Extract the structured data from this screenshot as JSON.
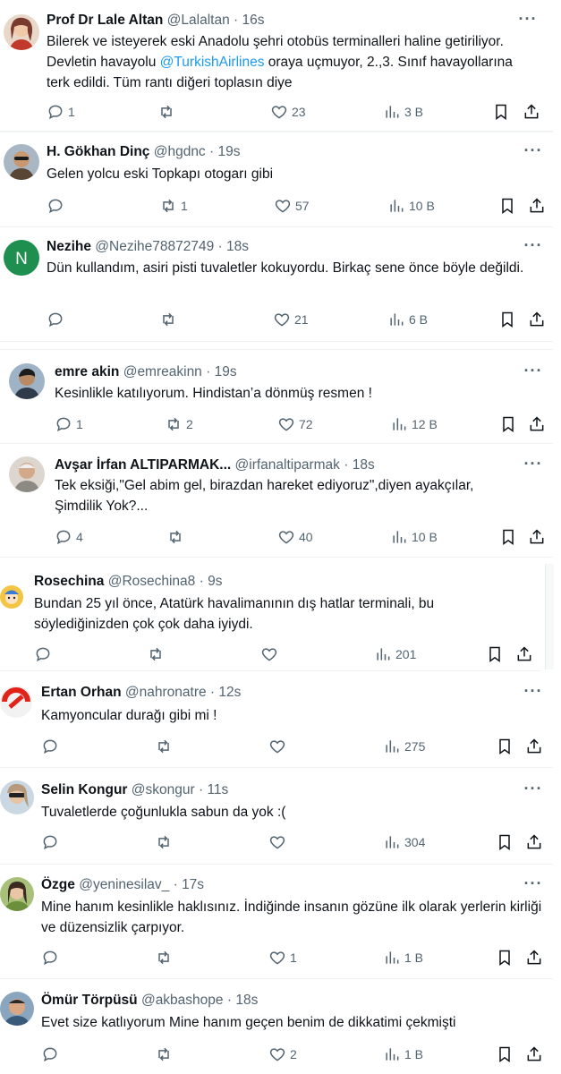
{
  "tweets": [
    {
      "name": "Prof Dr Lale Altan",
      "handle": "@Lalaltan",
      "time": "16s",
      "text_before": "Bilerek ve isteyerek eski Anadolu şehri otobüs terminalleri haline getiriliyor. Devletin havayolu ",
      "mention": "@TurkishAirlines",
      "text_after": " oraya uçmuyor, 2.,3. Sınıf havayollarına terk edildi. Tüm rantı diğeri toplasın diye",
      "replies": "1",
      "retweets": "",
      "likes": "23",
      "views": "3 B",
      "avatar_color": "#7a3a2e"
    },
    {
      "name": "H. Gökhan Dinç",
      "handle": "@hgdnc",
      "time": "19s",
      "text": "Gelen yolcu eski Topkapı otogarı gibi",
      "replies": "",
      "retweets": "1",
      "likes": "57",
      "views": "10 B",
      "avatar_color": "#5a4634"
    },
    {
      "name": "Nezihe",
      "handle": "@Nezihe78872749",
      "time": "18s",
      "text": "Dün kullandım, asiri pisti  tuvaletler kokuyordu. Birkaç sene önce böyle değildi.",
      "replies": "",
      "retweets": "",
      "likes": "21",
      "views": "6 B",
      "avatar_letter": "N",
      "avatar_color": "#1e8f4e"
    },
    {
      "name": "emre akin",
      "handle": "@emreakinn",
      "time": "19s",
      "text": "Kesinlikle katılıyorum. Hindistan’a dönmüş resmen !",
      "replies": "1",
      "retweets": "2",
      "likes": "72",
      "views": "12 B",
      "avatar_color": "#2f3b4a"
    },
    {
      "name": "Avşar İrfan ALTIPARMAK...",
      "handle": "@irfanaltiparmak",
      "time": "18s",
      "text": "Tek eksiği,\"Gel abim gel, birazdan hareket ediyoruz\",diyen ayakçılar, Şimdilik Yok?...",
      "replies": "4",
      "retweets": "",
      "likes": "40",
      "views": "10 B",
      "avatar_color": "#8d8a84"
    },
    {
      "name": "Rosechina",
      "handle": "@Rosechina8",
      "time": "9s",
      "text": "Bundan 25 yıl önce, Atatürk havalimanının dış hatlar terminali, bu söylediğinizden çok çok daha iyiydi.",
      "replies": "",
      "retweets": "",
      "likes": "",
      "views": "201",
      "avatar_color": "#3a7bd5"
    },
    {
      "name": "Ertan Orhan",
      "handle": "@nahronatre",
      "time": "12s",
      "text": "Kamyoncular durağı gibi mi !",
      "replies": "",
      "retweets": "",
      "likes": "",
      "views": "275",
      "avatar_color": "#e2231a"
    },
    {
      "name": "Selin Kongur",
      "handle": "@skongur",
      "time": "11s",
      "text": "Tuvaletlerde çoğunlukla sabun da yok :(",
      "replies": "",
      "retweets": "",
      "likes": "",
      "views": "304",
      "avatar_color": "#b79a7c"
    },
    {
      "name": "Özge",
      "handle": "@yeninesilav_",
      "time": "17s",
      "text": "Mine hanım kesinlikle haklısınız. İndiğinde insanın gözüne ilk olarak yerlerin kirliği ve düzensizlik çarpıyor.",
      "replies": "",
      "retweets": "",
      "likes": "1",
      "views": "1 B",
      "avatar_color": "#6b8f3a"
    },
    {
      "name": "Ömür Törpüsü",
      "handle": "@akbashope",
      "time": "18s",
      "text": "Evet size katlıyorum Mine hanım geçen benim de dikkatimi çekmişti",
      "replies": "",
      "retweets": "",
      "likes": "2",
      "views": "1 B",
      "avatar_color": "#3a5a7a"
    }
  ]
}
